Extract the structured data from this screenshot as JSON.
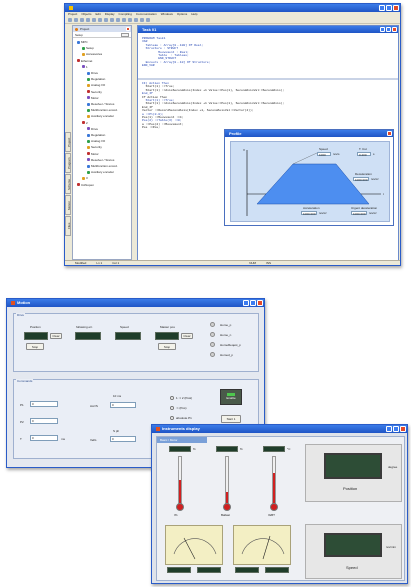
{
  "ide": {
    "menu": [
      "Project",
      "Objects",
      "Edit",
      "Display",
      "Compiling",
      "Communication",
      "Windows",
      "Options",
      "Help"
    ],
    "project_panel_title": "Project",
    "setup_label": "Setup",
    "tree": [
      {
        "label": "MPC",
        "indent": 0
      },
      {
        "label": "Setup",
        "indent": 1
      },
      {
        "label": "Accessories",
        "indent": 1
      },
      {
        "label": "Ethernet",
        "indent": 0
      },
      {
        "label": "1",
        "indent": 1
      },
      {
        "label": "Drive",
        "indent": 2
      },
      {
        "label": "Regulation",
        "indent": 2
      },
      {
        "label": "Analog I/O",
        "indent": 2
      },
      {
        "label": "Security",
        "indent": 2
      },
      {
        "label": "Motor",
        "indent": 2
      },
      {
        "label": "Resolver / Sincos",
        "indent": 2
      },
      {
        "label": "Multifunction encod.",
        "indent": 2
      },
      {
        "label": "Auxiliary encoder",
        "indent": 2
      },
      {
        "label": "2",
        "indent": 1
      },
      {
        "label": "Drive",
        "indent": 2
      },
      {
        "label": "Regulation",
        "indent": 2
      },
      {
        "label": "Analog I/O",
        "indent": 2
      },
      {
        "label": "Security",
        "indent": 2
      },
      {
        "label": "Motor",
        "indent": 2
      },
      {
        "label": "Resolver / Sincos",
        "indent": 2
      },
      {
        "label": "Multifunction encod.",
        "indent": 2
      },
      {
        "label": "Auxiliary encoder",
        "indent": 2
      },
      {
        "label": "3",
        "indent": 1
      },
      {
        "label": "CANopen",
        "indent": 0
      }
    ],
    "side_tabs": [
      "Project",
      "Program",
      "Scheme",
      "Motion",
      "Files"
    ],
    "editor_title": "Task 01",
    "code_lines": [
      "PROGRAM Task1",
      "",
      "VAR",
      "  Tableau : Array[0..100] Of Real;",
      "  Structure : STRUCT",
      "         Mouvement : Real;",
      "         Table  : Tableau;",
      "         END_STRUCT",
      "  Encours : Array[0..10] Of Structure;",
      "END_VAR"
    ],
    "code_lines_2": [
      "IF( Action Then",
      "  Start(1) :=True;",
      "  Start(1) :=AxisSecondAxis(Index +1 Value:=Pos(1), SecondAxisVal:=SecondAxis);",
      "End_If",
      "",
      "If Action Then",
      "  Start(1) :=True;",
      "  Start(1) :=AxisSecondAxis(Index +1 Value:=Pos(1), SecondAxisVal:=SecondAxis);",
      "End_If",
      "",
      "Vector :=RecordSecondAxis(Index +1, SecondAxisVal:=Vector(4));",
      "",
      "a :=Pl(0.0);",
      "",
      "Pos(1) :=Mouvement :=4;",
      "Pos(2) :=Table(3) :=0;",
      "a :=Pos(2) :=Mouvement;",
      "Pos :=Pos;"
    ],
    "profile": {
      "title": "Profile",
      "speed_label": "Speed",
      "speed_value": "1000",
      "speed_unit": "rev/s",
      "tcut_label": "T. Cut",
      "tcut_value": "0.200",
      "tcut_unit": "s",
      "accel_label": "Acceleration",
      "accel_value": "1000.000",
      "accel_unit": "rev/s²",
      "decel_label": "Deceleration",
      "decel_value": "1000.000",
      "decel_unit": "rev/s²",
      "urgent_label": "Urgent deceleration",
      "urgent_value": "1000.000",
      "axis_v": "V",
      "axis_t": "t"
    },
    "status": [
      "Modified",
      "Ln 1",
      "Col 1",
      "NUM",
      "INS"
    ]
  },
  "motion": {
    "title": "Motion",
    "group_drive": "Drive",
    "labels": [
      "Position",
      "following err.",
      "Speed",
      "Master pos"
    ],
    "clear_label": "Clear",
    "stop_label": "Stop",
    "leds": [
      "Home_p",
      "Home_n",
      "HomeReqest_p",
      "Homed_p"
    ],
    "group_commands": "Commands",
    "p1_label": "P1",
    "p1_value": "0",
    "p2_label": "P2",
    "p2_value": "0",
    "t_label": "T",
    "t_value": "0",
    "t_unit": "ms",
    "acc_label": "Acc/S",
    "acc_value": "0",
    "vel_label": "VelG",
    "vel_value": "0",
    "dead_label": "10 ms",
    "s_label": "S ph",
    "radios": [
      "1 ⇒ 2 (Posi)",
      "⇒ (Pos)",
      "absolute P1"
    ],
    "enable_label": "Enable",
    "start_label": "Start 1"
  },
  "instruments": {
    "title": "Instruments display",
    "group": "Basic / Motor",
    "gauges": [
      {
        "label": "I%",
        "unit": "%",
        "level": 0.48,
        "color": "#d02020"
      },
      {
        "label": "Ballast",
        "unit": "%",
        "level": 0.22,
        "color": "#d02020"
      },
      {
        "label": "IGBT",
        "unit": "°C",
        "level": 0.62,
        "color": "#d02020"
      }
    ],
    "position_label": "Position",
    "position_unit": "degree",
    "speed_label": "Speed",
    "speed_unit": "rev/min"
  }
}
